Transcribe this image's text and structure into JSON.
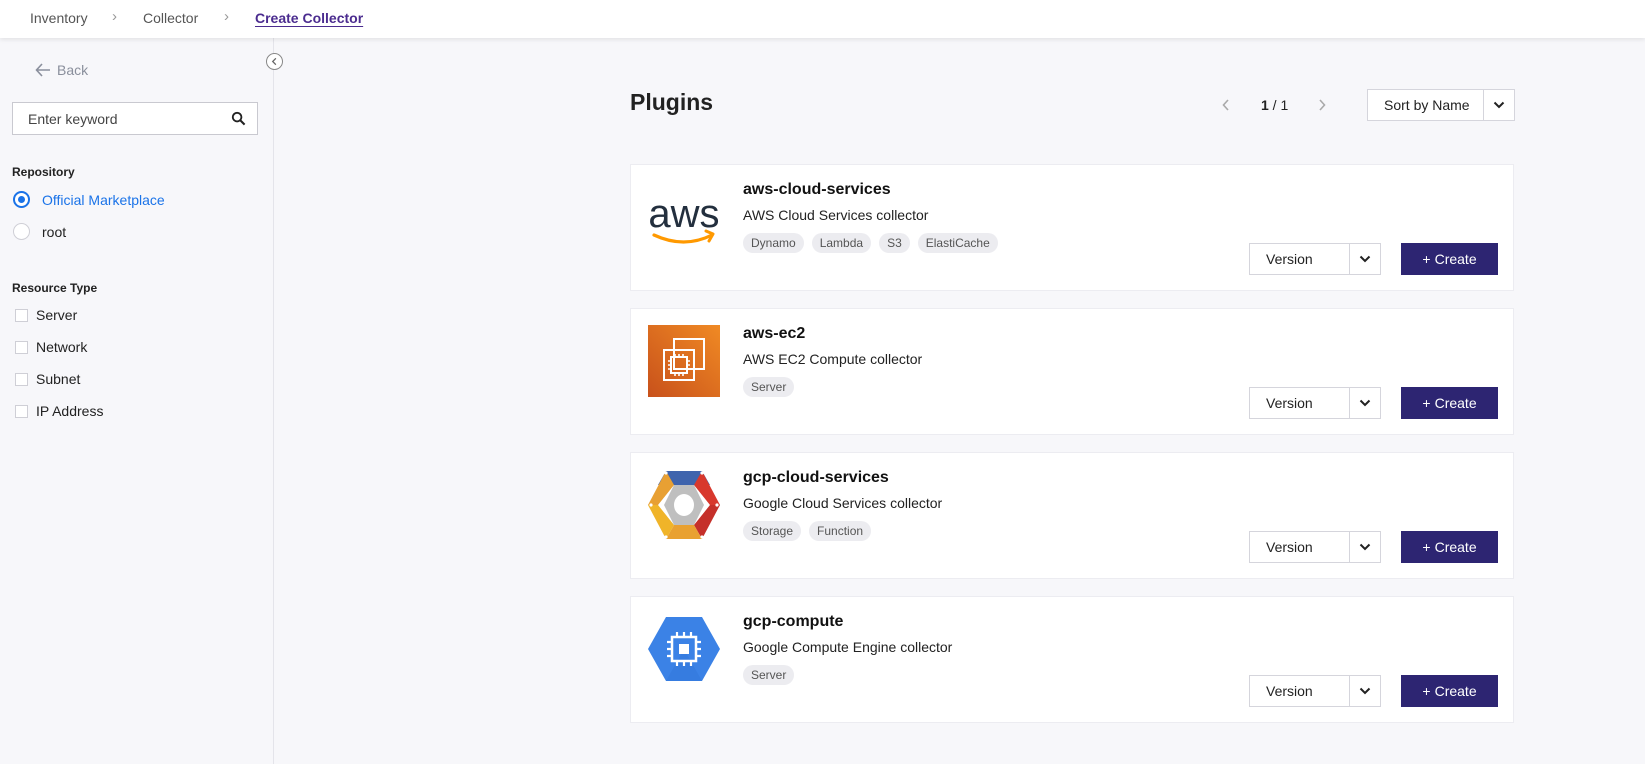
{
  "breadcrumb": {
    "items": [
      "Inventory",
      "Collector",
      "Create Collector"
    ]
  },
  "sidebar": {
    "back_label": "Back",
    "search_placeholder": "Enter keyword",
    "repository_title": "Repository",
    "repositories": [
      {
        "label": "Official Marketplace",
        "selected": true
      },
      {
        "label": "root",
        "selected": false
      }
    ],
    "resource_type_title": "Resource Type",
    "resource_types": [
      {
        "label": "Server",
        "checked": false
      },
      {
        "label": "Network",
        "checked": false
      },
      {
        "label": "Subnet",
        "checked": false
      },
      {
        "label": "IP Address",
        "checked": false
      }
    ]
  },
  "main": {
    "title": "Plugins",
    "pager": {
      "current": "1",
      "separator": " / ",
      "total": "1"
    },
    "sort_label": "Sort by Name",
    "version_label": "Version",
    "create_label": "Create",
    "plugins": [
      {
        "name": "aws-cloud-services",
        "description": "AWS Cloud Services collector",
        "tags": [
          "Dynamo",
          "Lambda",
          "S3",
          "ElastiCache"
        ],
        "icon": "aws-logo-icon"
      },
      {
        "name": "aws-ec2",
        "description": "AWS EC2 Compute collector",
        "tags": [
          "Server"
        ],
        "icon": "aws-ec2-icon"
      },
      {
        "name": "gcp-cloud-services",
        "description": "Google Cloud Services collector",
        "tags": [
          "Storage",
          "Function"
        ],
        "icon": "gcp-cloud-services-icon"
      },
      {
        "name": "gcp-compute",
        "description": "Google Compute Engine collector",
        "tags": [
          "Server"
        ],
        "icon": "gcp-compute-icon"
      }
    ]
  },
  "colors": {
    "accent": "#2d2572",
    "breadcrumb_active": "#4b2c8f",
    "radio_active": "#1a73e8",
    "aws_orange": "#ff9900",
    "ec2_orange": "#e8691d",
    "gcp_blue": "#3b82e6"
  }
}
